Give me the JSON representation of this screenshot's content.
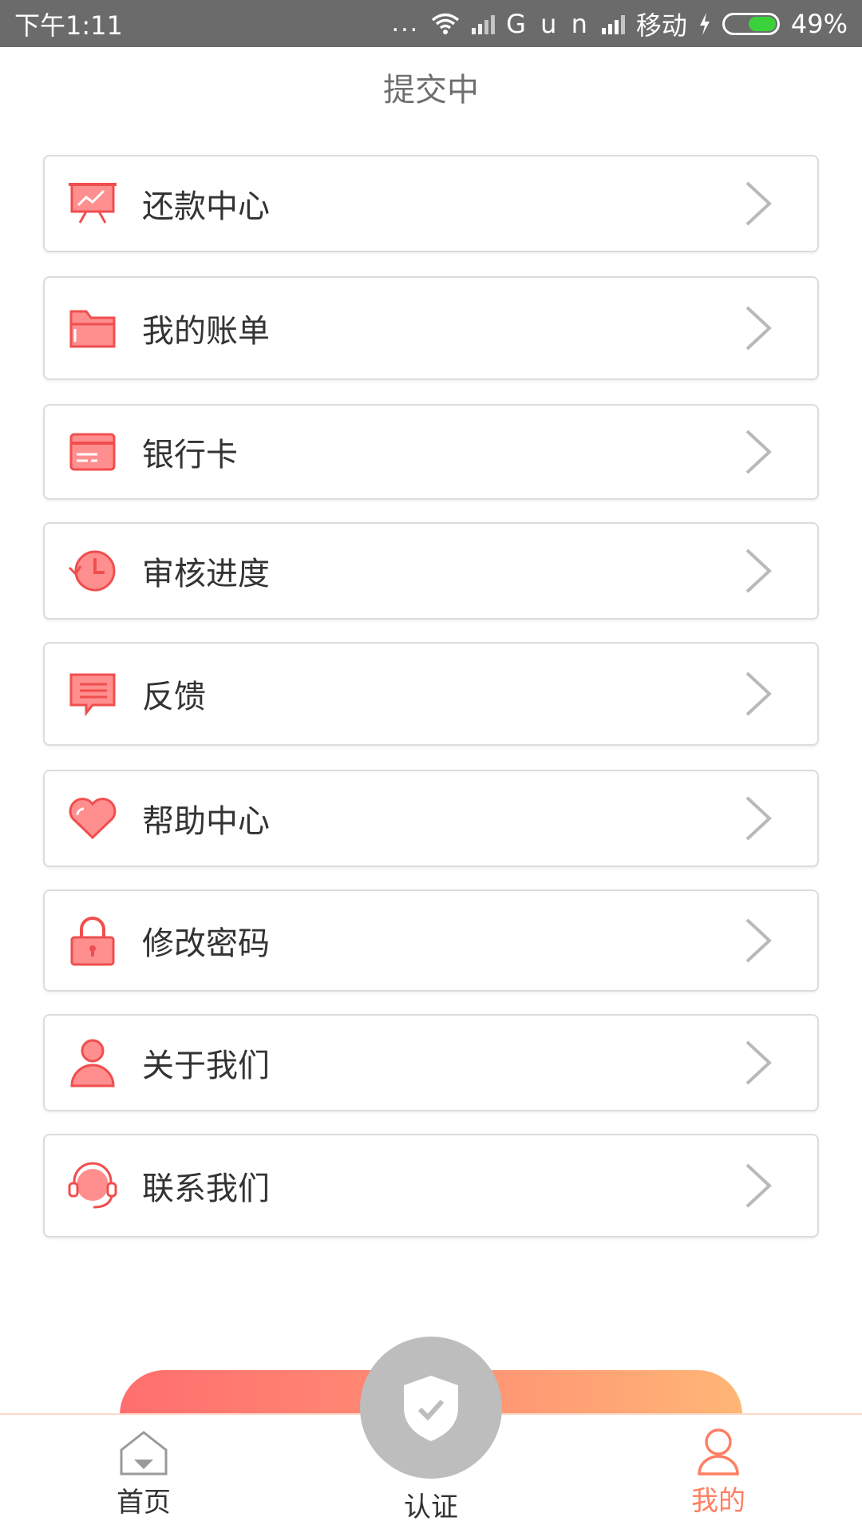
{
  "status_bar": {
    "time": "下午1:11",
    "dots": "...",
    "network": "G u n",
    "carrier": "移动",
    "battery": "49%"
  },
  "page": {
    "title": "提交中"
  },
  "menu": {
    "items": [
      {
        "label": "还款中心",
        "icon": "presentation-chart-icon"
      },
      {
        "label": "我的账单",
        "icon": "folder-icon"
      },
      {
        "label": "银行卡",
        "icon": "credit-card-icon"
      },
      {
        "label": "审核进度",
        "icon": "clock-history-icon"
      },
      {
        "label": "反馈",
        "icon": "chat-message-icon"
      },
      {
        "label": "帮助中心",
        "icon": "heart-icon"
      },
      {
        "label": "修改密码",
        "icon": "lock-icon"
      },
      {
        "label": "关于我们",
        "icon": "user-icon"
      },
      {
        "label": "联系我们",
        "icon": "headset-icon"
      }
    ]
  },
  "tabbar": {
    "home": "首页",
    "verify": "认证",
    "mine": "我的"
  },
  "colors": {
    "accent": "#ff7f63",
    "icon_red": "#f04e4e",
    "icon_fill": "#ff8f8f",
    "gradient_start": "#ff6e6e",
    "gradient_end": "#ffb676"
  }
}
